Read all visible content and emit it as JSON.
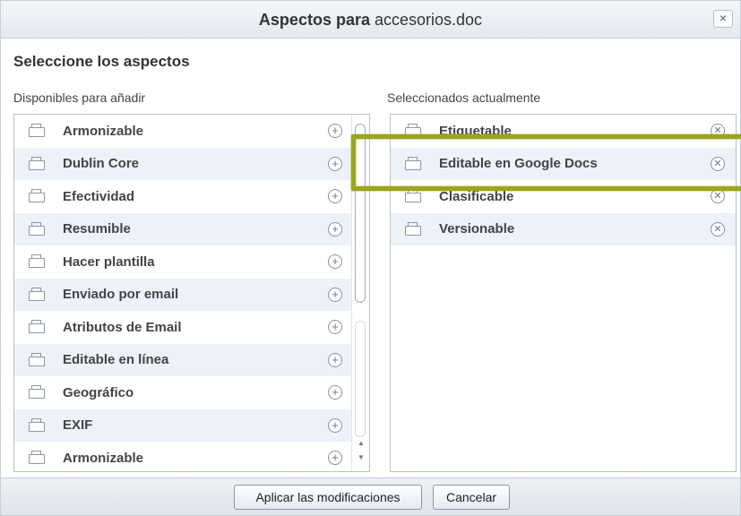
{
  "dialog": {
    "title_bold": "Aspectos para",
    "title_file": "accesorios.doc",
    "close_label": "×",
    "heading": "Seleccione los aspectos"
  },
  "available": {
    "label": "Disponibles para añadir",
    "add_icon": "plus-circle",
    "items": [
      "Armonizable",
      "Dublin Core",
      "Efectividad",
      "Resumible",
      "Hacer plantilla",
      "Enviado por email",
      "Atributos de Email",
      "Editable en línea",
      "Geográfico",
      "EXIF",
      "Armonizable"
    ]
  },
  "selected": {
    "label": "Seleccionados actualmente",
    "remove_icon": "x-circle",
    "items": [
      "Etiquetable",
      "Editable en Google Docs",
      "Clasificable",
      "Versionable"
    ]
  },
  "footer": {
    "apply_label": "Aplicar las modificaciones",
    "cancel_label": "Cancelar"
  },
  "colors": {
    "highlight": "#9aa51f",
    "row_alt": "#edf1f8"
  }
}
